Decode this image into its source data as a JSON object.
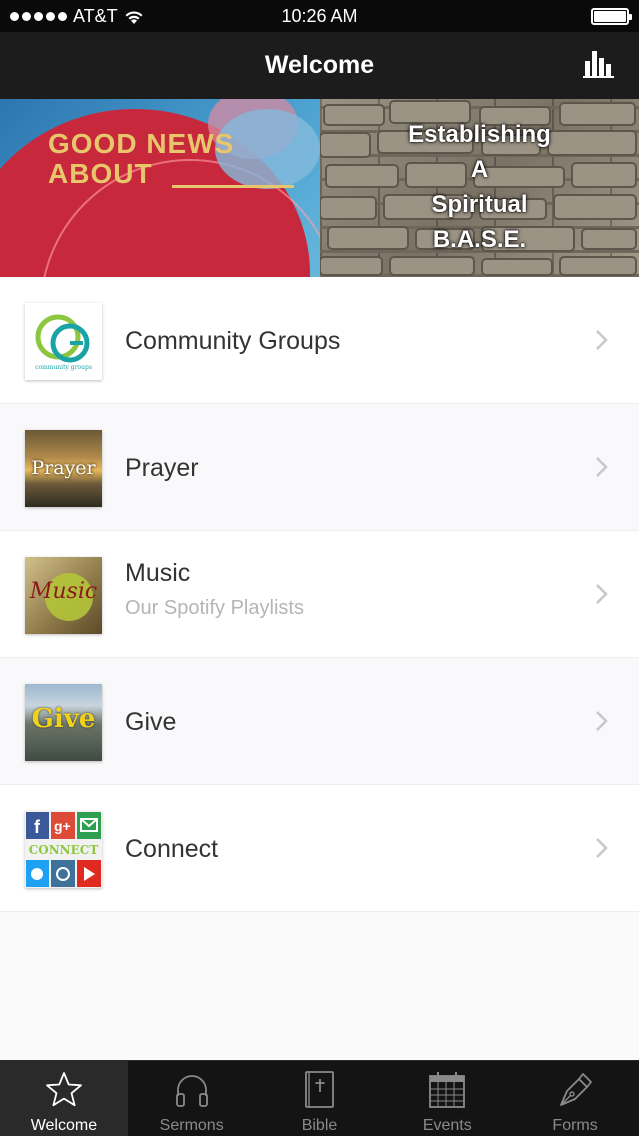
{
  "status_bar": {
    "carrier": "AT&T",
    "time": "10:26 AM"
  },
  "nav": {
    "title": "Welcome",
    "stats_icon": "bar-chart-icon"
  },
  "banner": {
    "left_text_line1": "GOOD NEWS",
    "left_text_line2": "ABOUT",
    "right_text": [
      "Establishing",
      "A",
      "Spiritual",
      "B.A.S.E."
    ]
  },
  "list": {
    "items": [
      {
        "title": "Community Groups",
        "subtitle": "",
        "thumb_text": "community groups"
      },
      {
        "title": "Prayer",
        "subtitle": "",
        "thumb_text": "Prayer"
      },
      {
        "title": "Music",
        "subtitle": "Our Spotify Playlists",
        "thumb_text": "Music"
      },
      {
        "title": "Give",
        "subtitle": "",
        "thumb_text": "Give"
      },
      {
        "title": "Connect",
        "subtitle": "",
        "thumb_text": "CONNECT"
      }
    ]
  },
  "tabs": [
    {
      "label": "Welcome",
      "icon": "star-icon",
      "active": true
    },
    {
      "label": "Sermons",
      "icon": "headphones-icon",
      "active": false
    },
    {
      "label": "Bible",
      "icon": "bible-icon",
      "active": false
    },
    {
      "label": "Events",
      "icon": "calendar-icon",
      "active": false
    },
    {
      "label": "Forms",
      "icon": "pen-nib-icon",
      "active": false
    }
  ],
  "colors": {
    "nav_bg": "#1c1c1c",
    "tab_bar_bg": "#141414",
    "active_tab_bg": "#2a2a2a",
    "chevron": "#c7c7cc"
  }
}
